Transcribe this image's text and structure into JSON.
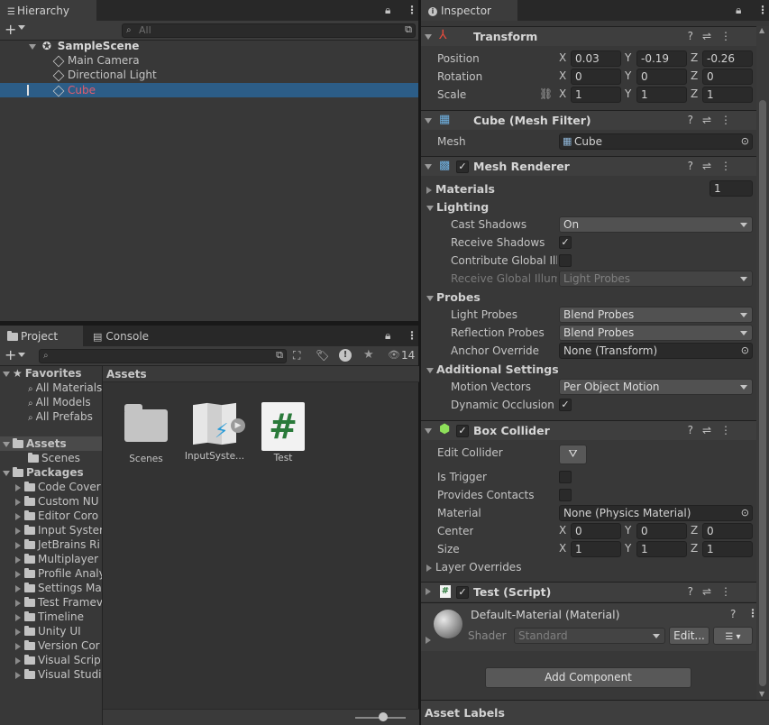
{
  "hierarchy": {
    "tab_label": "Hierarchy",
    "search_placeholder": "All",
    "scene": "SampleScene",
    "items": [
      "Main Camera",
      "Directional Light",
      "Cube"
    ]
  },
  "project": {
    "tab_label": "Project",
    "console_tab_label": "Console",
    "hidden_count": "14",
    "breadcrumb": "Assets",
    "favorites_label": "Favorites",
    "favorites": [
      "All Materials",
      "All Models",
      "All Prefabs"
    ],
    "assets_label": "Assets",
    "assets_children": [
      "Scenes"
    ],
    "packages_label": "Packages",
    "packages": [
      "Code Coverage",
      "Custom NUnit",
      "Editor Coroutines",
      "Input System",
      "JetBrains Rider",
      "Multiplayer",
      "Profile Analyzer",
      "Settings Manager",
      "Test Framework",
      "Timeline",
      "Unity UI",
      "Version Control",
      "Visual Scripting",
      "Visual Studio"
    ],
    "packages_display": [
      "Code Cover",
      "Custom NU",
      "Editor Coro",
      "Input Syster",
      "JetBrains Ri",
      "Multiplayer",
      "Profile Analy",
      "Settings Ma",
      "Test Framev",
      "Timeline",
      "Unity UI",
      "Version Cor",
      "Visual Scrip",
      "Visual Studi"
    ],
    "grid_items": [
      "Scenes",
      "InputSyste...",
      "Test"
    ],
    "script_glyph": "#"
  },
  "inspector": {
    "tab_label": "Inspector",
    "transform": {
      "title": "Transform",
      "position_label": "Position",
      "rotation_label": "Rotation",
      "scale_label": "Scale",
      "position": [
        "0.03",
        "-0.19",
        "-0.26"
      ],
      "rotation": [
        "0",
        "0",
        "0"
      ],
      "scale": [
        "1",
        "1",
        "1"
      ]
    },
    "mesh_filter": {
      "title": "Cube (Mesh Filter)",
      "mesh_label": "Mesh",
      "mesh_value": "Cube"
    },
    "mesh_renderer": {
      "title": "Mesh Renderer",
      "materials_label": "Materials",
      "materials_count": "1",
      "lighting_label": "Lighting",
      "cast_shadows_label": "Cast Shadows",
      "cast_shadows_value": "On",
      "receive_shadows_label": "Receive Shadows",
      "contribute_gi_label": "Contribute Global Illu",
      "receive_gi_label": "Receive Global Illumi",
      "receive_gi_value": "Light Probes",
      "probes_label": "Probes",
      "light_probes_label": "Light Probes",
      "light_probes_value": "Blend Probes",
      "reflection_probes_label": "Reflection Probes",
      "reflection_probes_value": "Blend Probes",
      "anchor_override_label": "Anchor Override",
      "anchor_override_value": "None (Transform)",
      "additional_label": "Additional Settings",
      "motion_vectors_label": "Motion Vectors",
      "motion_vectors_value": "Per Object Motion",
      "dynamic_occlusion_label": "Dynamic Occlusion"
    },
    "box_collider": {
      "title": "Box Collider",
      "edit_collider_label": "Edit Collider",
      "is_trigger_label": "Is Trigger",
      "provides_contacts_label": "Provides Contacts",
      "material_label": "Material",
      "material_value": "None (Physics Material)",
      "center_label": "Center",
      "size_label": "Size",
      "center": [
        "0",
        "0",
        "0"
      ],
      "size": [
        "1",
        "1",
        "1"
      ],
      "layer_overrides_label": "Layer Overrides"
    },
    "script": {
      "title": "Test (Script)"
    },
    "material": {
      "name": "Default-Material (Material)",
      "shader_label": "Shader",
      "shader_value": "Standard",
      "edit_label": "Edit..."
    },
    "add_component_label": "Add Component",
    "asset_labels": "Asset Labels",
    "axis_labels": [
      "X",
      "Y",
      "Z"
    ],
    "check_glyph": "✓"
  },
  "colors": {
    "selection": "#2c5d87",
    "selected_text": "#e25d6e",
    "script_green": "#2a7a3a"
  }
}
